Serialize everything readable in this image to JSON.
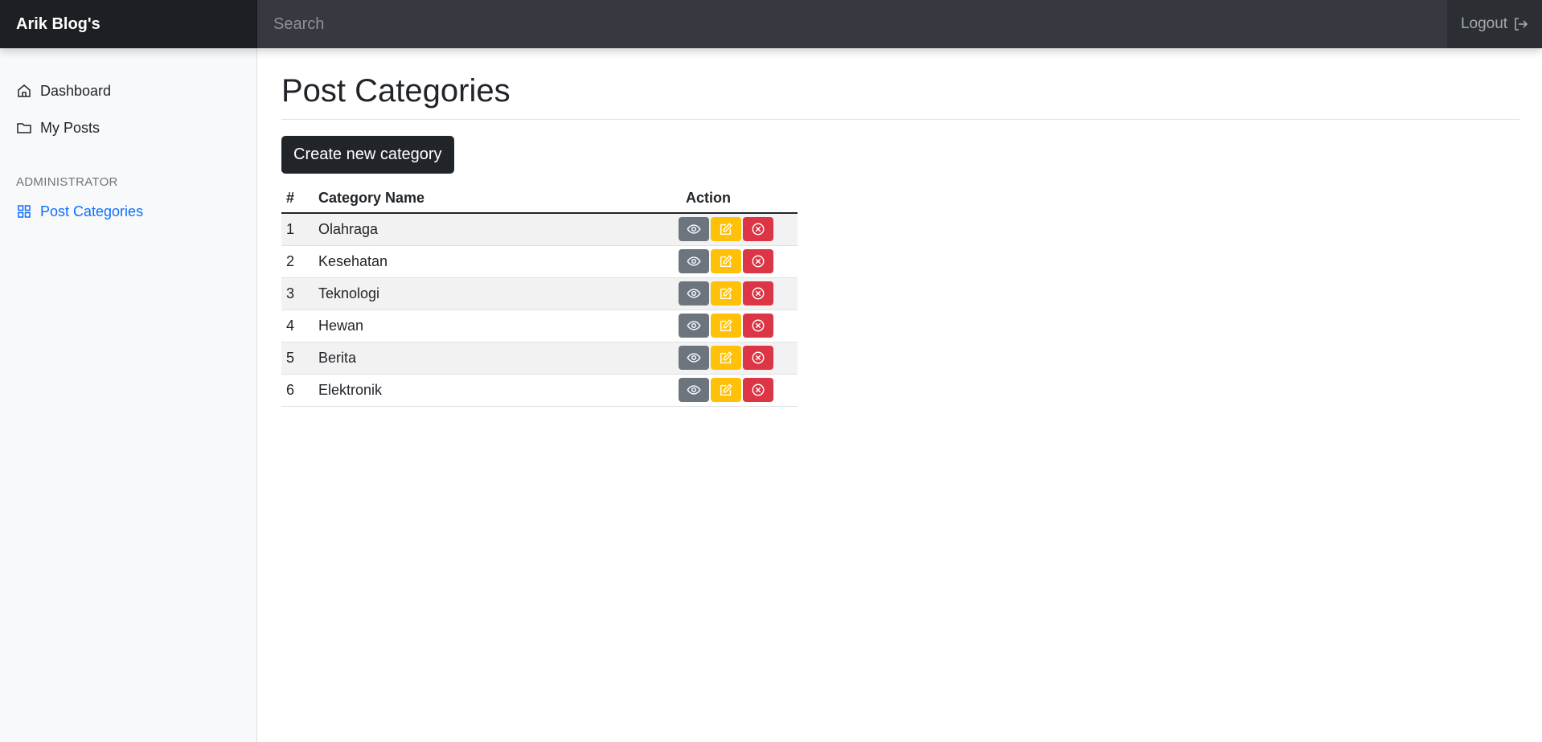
{
  "navbar": {
    "brand": "Arik Blog's",
    "search_placeholder": "Search",
    "logout_label": "Logout"
  },
  "sidebar": {
    "items": [
      {
        "label": "Dashboard",
        "icon": "home-icon"
      },
      {
        "label": "My Posts",
        "icon": "folder-icon"
      }
    ],
    "admin_heading": "ADMINISTRATOR",
    "admin_items": [
      {
        "label": "Post Categories",
        "icon": "grid-icon",
        "active": true
      }
    ]
  },
  "main": {
    "title": "Post Categories",
    "create_button": "Create new category",
    "table": {
      "headers": [
        "#",
        "Category Name",
        "Action"
      ],
      "rows": [
        {
          "no": "1",
          "name": "Olahraga"
        },
        {
          "no": "2",
          "name": "Kesehatan"
        },
        {
          "no": "3",
          "name": "Teknologi"
        },
        {
          "no": "4",
          "name": "Hewan"
        },
        {
          "no": "5",
          "name": "Berita"
        },
        {
          "no": "6",
          "name": "Elektronik"
        }
      ],
      "row_actions": [
        "eye-icon",
        "edit-icon",
        "delete-icon"
      ]
    }
  },
  "colors": {
    "navbar": "#212529",
    "accent": "#0d6efd",
    "view": "#6c757d",
    "edit": "#ffc107",
    "delete": "#dc3545"
  }
}
